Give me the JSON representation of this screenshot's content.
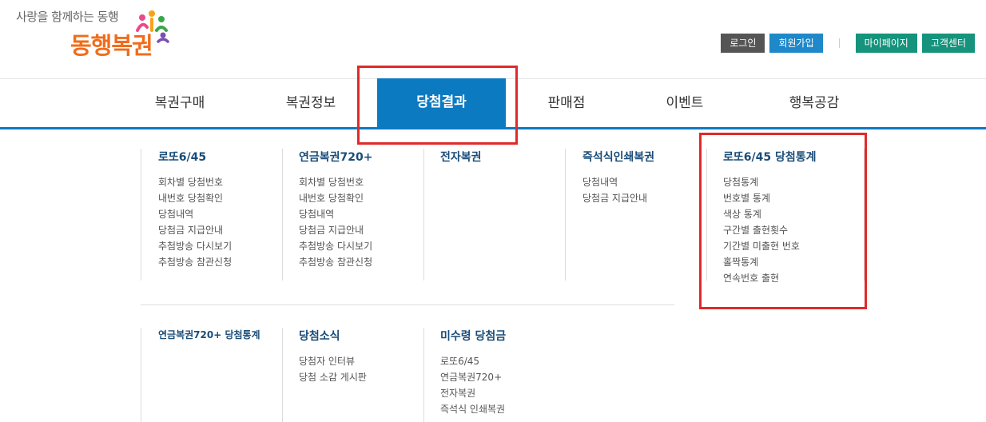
{
  "header": {
    "slogan": "사랑을 함께하는 동행",
    "logo_text": "동행복권",
    "buttons": {
      "login": "로그인",
      "join": "회원가입",
      "mypage": "마이페이지",
      "customer": "고객센터"
    }
  },
  "nav": {
    "items": [
      "복권구매",
      "복권정보",
      "당첨결과",
      "판매점",
      "이벤트",
      "행복공감"
    ],
    "active": "당첨결과"
  },
  "menu": {
    "row1": [
      {
        "title": "로또6/45",
        "links": [
          "회차별 당첨번호",
          "내번호 당첨확인",
          "당첨내역",
          "당첨금 지급안내",
          "추첨방송 다시보기",
          "추첨방송 참관신청"
        ]
      },
      {
        "title": "연금복권720+",
        "links": [
          "회차별 당첨번호",
          "내번호 당첨확인",
          "당첨내역",
          "당첨금 지급안내",
          "추첨방송 다시보기",
          "추첨방송 참관신청"
        ]
      },
      {
        "title": "전자복권",
        "links": []
      },
      {
        "title": "즉석식인쇄복권",
        "links": [
          "당첨내역",
          "당첨금 지급안내"
        ]
      },
      {
        "title": "로또6/45 당첨통계",
        "links": [
          "당첨통계",
          "번호별 통계",
          "색상 통계",
          "구간별 출현횟수",
          "기간별 미출현 번호",
          "홀짝통계",
          "연속번호 출현"
        ]
      }
    ],
    "row2": [
      {
        "title": "연금복권720+ 당첨통계",
        "links": []
      },
      {
        "title": "당첨소식",
        "links": [
          "당첨자 인터뷰",
          "당첨 소감 게시판"
        ]
      },
      {
        "title": "미수령 당첨금",
        "links": [
          "로또6/45",
          "연금복권720+",
          "전자복권",
          "즉석식 인쇄복권"
        ]
      }
    ]
  },
  "colors": {
    "brand_blue": "#0c7ac1",
    "menu_title": "#1a4c78",
    "highlight_red": "#e02a2a",
    "logo_orange": "#f26c1a"
  }
}
